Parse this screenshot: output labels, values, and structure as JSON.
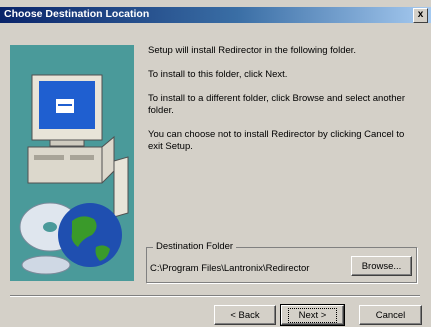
{
  "window": {
    "title": "Choose Destination Location",
    "close_glyph": "x"
  },
  "messages": [
    "Setup will install Redirector in the following folder.",
    "To install to this folder, click Next.",
    "To install to a different folder, click Browse and select another folder.",
    "You can choose not to install Redirector by clicking Cancel to exit Setup."
  ],
  "destination": {
    "label": "Destination Folder",
    "path": "C:\\Program Files\\Lantronix\\Redirector"
  },
  "buttons": {
    "browse": "Browse...",
    "back": "< Back",
    "next": "Next >",
    "cancel": "Cancel"
  },
  "colors": {
    "title_start": "#0a246a",
    "title_end": "#a6caf0",
    "panel": "#4a9a9a",
    "face": "#d4d0c8"
  },
  "icons": [
    "computer-icon",
    "cd-globe-icon"
  ]
}
